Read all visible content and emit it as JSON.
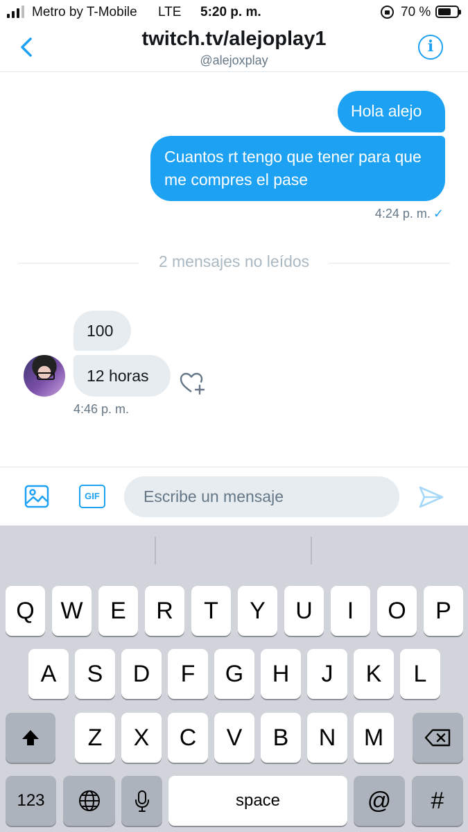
{
  "status_bar": {
    "carrier": "Metro by T-Mobile",
    "network": "LTE",
    "time": "5:20 p. m.",
    "battery_percent": "70 %",
    "battery_level": 0.7,
    "signal_bars_active": 3,
    "signal_bars_total": 4
  },
  "header": {
    "title": "twitch.tv/alejoplay1",
    "handle": "@alejoxplay",
    "back_icon": "chevron-left-icon",
    "info_icon": "info-icon",
    "info_glyph": "i"
  },
  "conversation": {
    "sent": [
      {
        "text": "Hola alejo"
      },
      {
        "text": "Cuantos rt tengo que tener para que me compres el pase"
      }
    ],
    "sent_time": "4:24 p. m.",
    "sent_status": "✓",
    "unread_divider": "2 mensajes no leídos",
    "received": [
      {
        "text": "100"
      },
      {
        "text": "12 horas"
      }
    ],
    "received_time": "4:46 p. m."
  },
  "composer": {
    "gif_label": "GIF",
    "placeholder": "Escribe un mensaje",
    "value": ""
  },
  "keyboard": {
    "row1": [
      "Q",
      "W",
      "E",
      "R",
      "T",
      "Y",
      "U",
      "I",
      "O",
      "P"
    ],
    "row2": [
      "A",
      "S",
      "D",
      "F",
      "G",
      "H",
      "J",
      "K",
      "L"
    ],
    "row3": [
      "Z",
      "X",
      "C",
      "V",
      "B",
      "N",
      "M"
    ],
    "numbers_label": "123",
    "space_label": "space",
    "at_label": "@",
    "hash_label": "#"
  },
  "colors": {
    "accent": "#1da1f2",
    "incoming_bubble": "#e6ecf0",
    "keyboard_bg": "#d1d4da"
  }
}
